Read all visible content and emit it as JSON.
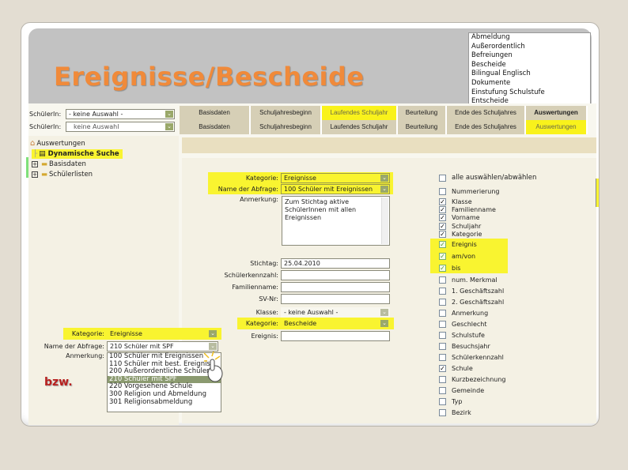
{
  "title": "Ereignisse/Bescheide",
  "category_listbox": {
    "options": [
      "Abmeldung",
      "Außerordentlich",
      "Befreiungen",
      "Bescheide",
      "Bilingual Englisch",
      "Dokumente",
      "Einstufung Schulstufe",
      "Entscheide"
    ]
  },
  "student_selects": [
    {
      "label": "SchülerIn:",
      "value": "- keine Auswahl -"
    },
    {
      "label": "SchülerIn:",
      "value": "keine Auswahl"
    }
  ],
  "tabs_top": [
    {
      "label": "Basisdaten",
      "highlight": false
    },
    {
      "label": "Schuljahresbeginn",
      "highlight": false
    },
    {
      "label": "Laufendes Schuljahr",
      "highlight": true
    },
    {
      "label": "Beurteilung",
      "highlight": false
    },
    {
      "label": "Ende des Schuljahres",
      "highlight": false
    },
    {
      "label": "Auswertungen",
      "highlight": false
    }
  ],
  "tabs_bottom": [
    {
      "label": "Basisdaten",
      "highlight": false
    },
    {
      "label": "Schuljahresbeginn",
      "highlight": false
    },
    {
      "label": "Laufendes Schuljahr",
      "highlight": false
    },
    {
      "label": "Beurteilung",
      "highlight": false
    },
    {
      "label": "Ende des Schuljahres",
      "highlight": false
    },
    {
      "label": "Auswertungen",
      "highlight": true
    }
  ],
  "tree": {
    "root": "Auswertungen",
    "items": [
      {
        "label": "Dynamische Suche",
        "selected": true
      },
      {
        "label": "Basisdaten",
        "selected": false
      },
      {
        "label": "Schülerlisten",
        "selected": false
      }
    ]
  },
  "form": {
    "kategorie_label": "Kategorie:",
    "kategorie_value": "Ereignisse",
    "abfrage_label": "Name der Abfrage:",
    "abfrage_value": "100 Schüler mit Ereignissen",
    "anmerkung_label": "Anmerkung:",
    "anmerkung_value": "Zum Stichtag aktive SchülerInnen mit allen Ereignissen",
    "stichtag_label": "Stichtag:",
    "stichtag_value": "25.04.2010",
    "schuelerkennzahl_label": "Schülerkennzahl:",
    "familienname_label": "Familienname:",
    "svnr_label": "SV-Nr:",
    "klasse_label": "Klasse:",
    "klasse_value": "- keine Auswahl -",
    "kategorie2_label": "Kategorie:",
    "kategorie2_value": "Bescheide",
    "ereignis_label": "Ereignis:"
  },
  "columns": {
    "select_all": "alle auswählen/abwählen",
    "items": [
      {
        "label": "Nummerierung",
        "checked": false,
        "highlight": false
      },
      {
        "label": "Klasse",
        "checked": true,
        "highlight": false
      },
      {
        "label": "Familienname",
        "checked": true,
        "highlight": false
      },
      {
        "label": "Vorname",
        "checked": true,
        "highlight": false
      },
      {
        "label": "Schuljahr",
        "checked": true,
        "highlight": false
      },
      {
        "label": "Kategorie",
        "checked": true,
        "highlight": false
      },
      {
        "label": "Ereignis",
        "checked": true,
        "highlight": true
      },
      {
        "label": "am/von",
        "checked": true,
        "highlight": true
      },
      {
        "label": "bis",
        "checked": true,
        "highlight": true
      },
      {
        "label": "num. Merkmal",
        "checked": false,
        "highlight": false
      },
      {
        "label": "1. Geschäftszahl",
        "checked": false,
        "highlight": false
      },
      {
        "label": "2. Geschäftszahl",
        "checked": false,
        "highlight": false
      },
      {
        "label": "Anmerkung",
        "checked": false,
        "highlight": false
      },
      {
        "label": "Geschlecht",
        "checked": false,
        "highlight": false
      },
      {
        "label": "Schulstufe",
        "checked": false,
        "highlight": false
      },
      {
        "label": "Besuchsjahr",
        "checked": false,
        "highlight": false
      },
      {
        "label": "Schülerkennzahl",
        "checked": false,
        "highlight": false
      },
      {
        "label": "Schule",
        "checked": true,
        "highlight": false
      },
      {
        "label": "Kurzbezeichnung",
        "checked": false,
        "highlight": false
      },
      {
        "label": "Gemeinde",
        "checked": false,
        "highlight": false
      },
      {
        "label": "Typ",
        "checked": false,
        "highlight": false
      },
      {
        "label": "Bezirk",
        "checked": false,
        "highlight": false
      }
    ]
  },
  "inset": {
    "kategorie_label": "Kategorie:",
    "kategorie_value": "Ereignisse",
    "abfrage_label": "Name der Abfrage:",
    "abfrage_value": "210 Schüler mit SPF",
    "anmerkung_label": "Anmerkung:",
    "bzw": "bzw.",
    "options": [
      {
        "label": "100 Schüler mit Ereignissen",
        "selected": false
      },
      {
        "label": "110 Schüler mit best. Ereignis",
        "selected": false
      },
      {
        "label": "200 Außerordentliche Schüler",
        "selected": false
      },
      {
        "label": "210 Schüler mit SPF",
        "selected": true
      },
      {
        "label": "220 Vorgesehene Schule",
        "selected": false
      },
      {
        "label": "300 Religion und Abmeldung",
        "selected": false
      },
      {
        "label": "301 Religionsabmeldung",
        "selected": false
      }
    ]
  },
  "colors": {
    "highlight": "#f9f21b",
    "title": "#f08a3a",
    "tab": "#d6cfb6",
    "selected_option": "#8b9a70",
    "bzw": "#b8201e"
  }
}
